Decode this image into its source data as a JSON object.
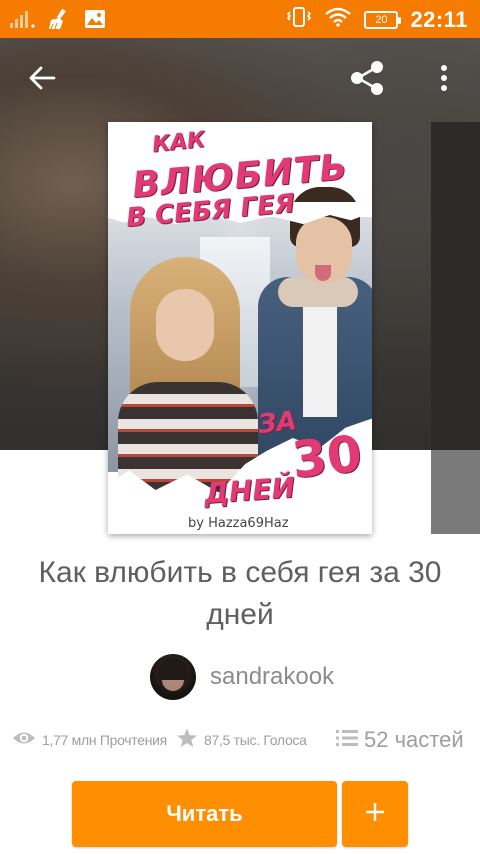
{
  "status_bar": {
    "battery": "20",
    "time": "22:11"
  },
  "story": {
    "title": "Как влюбить в себя гея за 30 дней",
    "cover": {
      "line1": "КАК",
      "line2": "ВЛЮБИТЬ",
      "line3": "В СЕБЯ ГЕЯ",
      "line4": "ЗА",
      "line5": "30",
      "line6": "ДНЕЙ",
      "byline": "by Hazza69Haz"
    },
    "author": "sandrakook",
    "stats": {
      "reads": "1,77 млн Прочтения",
      "votes": "87,5 тыс. Голоса",
      "parts": "52 частей"
    }
  },
  "actions": {
    "read_label": "Читать",
    "add_label": "+"
  },
  "colors": {
    "accent": "#ff8f00",
    "status_bar": "#f57c00",
    "cover_title": "#e23b73",
    "text_secondary": "#9e9e9e"
  },
  "icons": {
    "back": "arrow-left-icon",
    "share": "share-icon",
    "more": "more-vertical-icon",
    "reads": "eye-icon",
    "votes": "star-icon",
    "parts": "list-icon"
  }
}
